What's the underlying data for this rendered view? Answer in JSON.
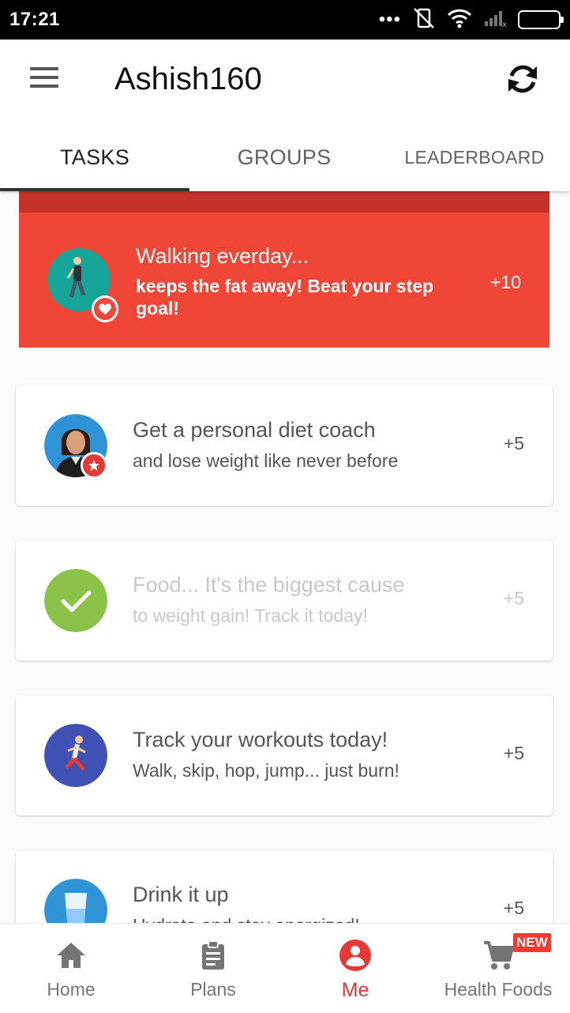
{
  "status_bar": {
    "time": "17:21",
    "dots": "•••",
    "battery_color": "#44d62c"
  },
  "app_bar": {
    "title": "Ashish160",
    "menu_icon": "hamburger-menu-icon",
    "sync_icon": "sync-icon"
  },
  "tabs": [
    {
      "label": "TASKS",
      "active": true
    },
    {
      "label": "GROUPS",
      "active": false
    },
    {
      "label": "LEADERBOARD",
      "active": false
    }
  ],
  "tasks": [
    {
      "title": "Walking everday...",
      "subtitle": "keeps the fat away! Beat your step goal!",
      "points": "+10",
      "icon": "walking-person-icon",
      "badge": "heart-icon",
      "highlight_color": "#ef4638"
    },
    {
      "title": "Get a personal diet coach",
      "subtitle": "and lose weight like never before",
      "points": "+5",
      "icon": "diet-coach-avatar",
      "badge": "star-icon"
    },
    {
      "title": "Food... It's the biggest cause",
      "subtitle": "to weight gain! Track it today!",
      "points": "+5",
      "icon": "checkmark-icon",
      "completed": true
    },
    {
      "title": "Track your workouts today!",
      "subtitle": "Walk, skip, hop, jump... just burn!",
      "points": "+5",
      "icon": "running-person-icon"
    },
    {
      "title": "Drink it up",
      "subtitle": "Hydrate and stay energized!",
      "points": "+5",
      "icon": "water-glass-icon"
    }
  ],
  "bottom_nav": [
    {
      "label": "Home",
      "icon": "home-icon",
      "active": false
    },
    {
      "label": "Plans",
      "icon": "clipboard-icon",
      "active": false
    },
    {
      "label": "Me",
      "icon": "person-icon",
      "active": true
    },
    {
      "label": "Health Foods",
      "icon": "cart-icon",
      "active": false,
      "badge": "NEW"
    }
  ],
  "colors": {
    "accent": "#e53935",
    "task_green": "#8bc34a",
    "task_blue": "#3f51b5",
    "task_teal": "#16a598",
    "water_blue": "#2f93d5"
  }
}
